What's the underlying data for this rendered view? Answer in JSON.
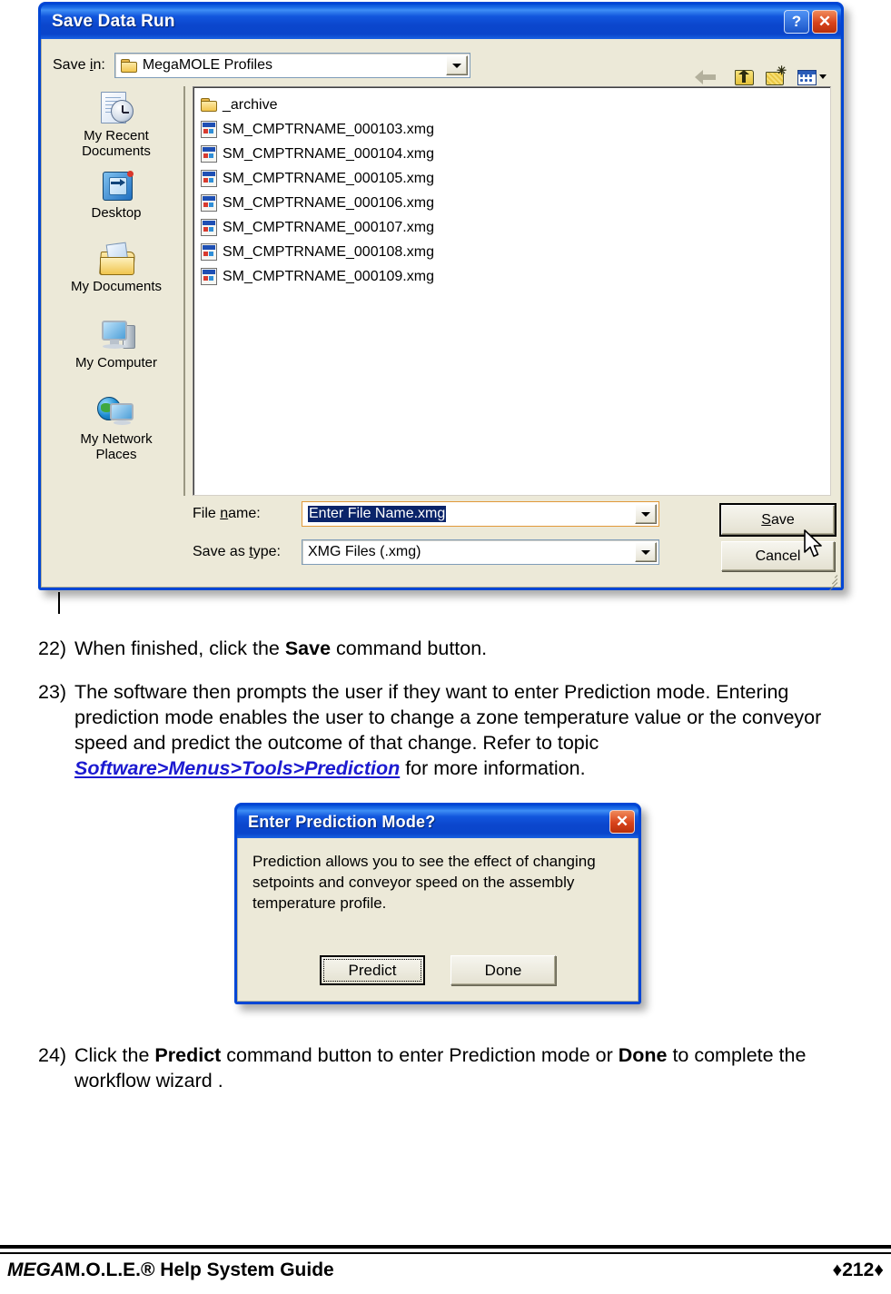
{
  "save_dialog": {
    "title": "Save Data Run",
    "title_buttons": {
      "help": "?",
      "close": "✕"
    },
    "save_in": {
      "label": "Save in:",
      "label_accel": "i",
      "value": "MegaMOLE Profiles"
    },
    "toolbar": {
      "back": "back-arrow",
      "up": "up-one-level",
      "new_folder": "create-new-folder",
      "views": "views-menu"
    },
    "places": [
      {
        "label_line1": "My Recent",
        "label_line2": "Documents",
        "icon": "recent-documents-icon"
      },
      {
        "label_line1": "Desktop",
        "label_line2": "",
        "icon": "desktop-icon"
      },
      {
        "label_line1": "My Documents",
        "label_line2": "",
        "icon": "my-documents-icon"
      },
      {
        "label_line1": "My Computer",
        "label_line2": "",
        "icon": "my-computer-icon"
      },
      {
        "label_line1": "My Network",
        "label_line2": "Places",
        "icon": "my-network-places-icon"
      }
    ],
    "files": [
      {
        "name": "_archive",
        "type": "folder"
      },
      {
        "name": "SM_CMPTRNAME_000103.xmg",
        "type": "file"
      },
      {
        "name": "SM_CMPTRNAME_000104.xmg",
        "type": "file"
      },
      {
        "name": "SM_CMPTRNAME_000105.xmg",
        "type": "file"
      },
      {
        "name": "SM_CMPTRNAME_000106.xmg",
        "type": "file"
      },
      {
        "name": "SM_CMPTRNAME_000107.xmg",
        "type": "file"
      },
      {
        "name": "SM_CMPTRNAME_000108.xmg",
        "type": "file"
      },
      {
        "name": "SM_CMPTRNAME_000109.xmg",
        "type": "file"
      }
    ],
    "file_name": {
      "label_pre": "File ",
      "label_accel": "n",
      "label_post": "ame:",
      "value": "Enter File Name.xmg"
    },
    "save_as_type": {
      "label_pre": "Save as ",
      "label_accel": "t",
      "label_post": "ype:",
      "value": "XMG Files (.xmg)"
    },
    "buttons": {
      "save_accel": "S",
      "save_rest": "ave",
      "cancel": "Cancel"
    }
  },
  "steps": {
    "step22": {
      "num": "22)",
      "a": "When finished, click the ",
      "b": "Save",
      "c": " command button."
    },
    "step23": {
      "num": "23)",
      "a": "The software then prompts the user if they want to enter Prediction mode. Entering prediction mode enables the user to change a zone temperature value or the conveyor speed and predict the outcome of that change. Refer to topic ",
      "link": "Software>Menus>Tools>Prediction",
      "c": " for more information."
    },
    "step24": {
      "num": "24)",
      "a": "Click the ",
      "b": "Predict",
      "c": " command button to enter Prediction mode or ",
      "d": "Done",
      "e": " to complete the workflow wizard ."
    }
  },
  "predict_dialog": {
    "title": "Enter Prediction Mode?",
    "close_label": "✕",
    "message": "Prediction allows you to see the effect of changing setpoints and conveyor speed on the assembly temperature profile.",
    "predict_button": "Predict",
    "done_button": "Done"
  },
  "footer": {
    "brand_italic": "MEGA",
    "brand_rest": "M.O.L.E.® Help System Guide",
    "page": "♦212♦"
  },
  "colors": {
    "titlebar_blue": "#0a46cd",
    "dialog_face": "#ece9d8",
    "selection_blue": "#0a246a",
    "link_blue": "#1b19d0",
    "close_red": "#d8431b"
  }
}
